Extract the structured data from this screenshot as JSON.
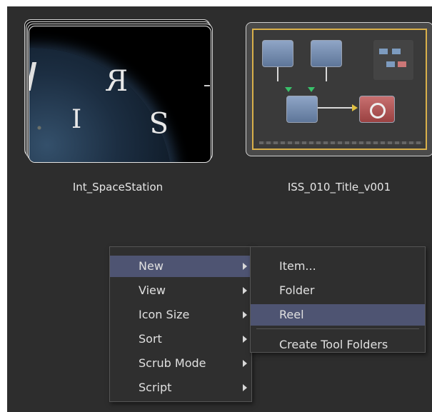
{
  "bin": {
    "items": [
      {
        "label": "Int_SpaceStation",
        "type": "stacked-clip"
      },
      {
        "label": "ISS_010_Title_v001",
        "type": "composition"
      }
    ]
  },
  "context_menu": {
    "items": [
      {
        "label": "New",
        "has_submenu": true,
        "highlighted": true
      },
      {
        "label": "View",
        "has_submenu": true
      },
      {
        "label": "Icon Size",
        "has_submenu": true
      },
      {
        "label": "Sort",
        "has_submenu": true
      },
      {
        "label": "Scrub Mode",
        "has_submenu": true
      },
      {
        "label": "Script",
        "has_submenu": true
      }
    ]
  },
  "submenu": {
    "items": [
      {
        "label": "Item..."
      },
      {
        "label": "Folder"
      },
      {
        "label": "Reel",
        "highlighted": true
      },
      {
        "label": "Create Tool Folders"
      }
    ]
  },
  "colors": {
    "panel_bg": "#2d2d2d",
    "menu_bg": "#2f2f2f",
    "highlight": "#4e5472",
    "text": "#e0e0e0"
  }
}
